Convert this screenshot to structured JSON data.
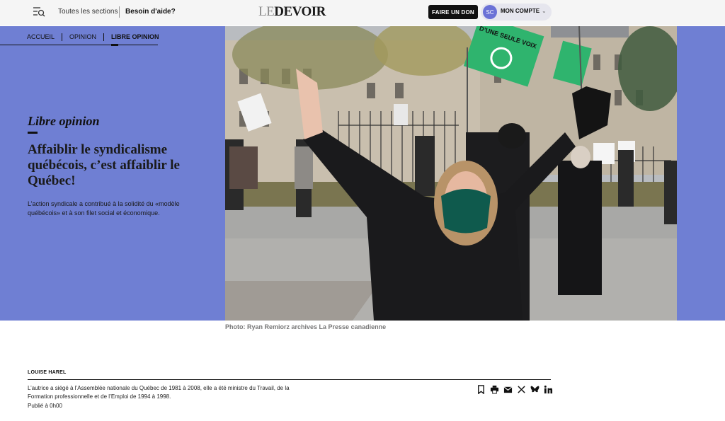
{
  "header": {
    "sections_label": "Toutes les sections",
    "help_label": "Besoin d'aide?",
    "logo_le": "LE",
    "logo_devoir": "DEVOIR",
    "donate_label": "FAIRE UN DON",
    "account_initials": "SC",
    "account_label": "MON COMPTE",
    "account_chevron": "⌄"
  },
  "breadcrumb": [
    "ACCUEIL",
    "OPINION",
    "LIBRE OPINION"
  ],
  "article": {
    "section": "Libre opinion",
    "headline": "Affaiblir le syndicalisme québécois, c’est affaiblir le Québec!",
    "dek": "L’action syndicale a contribué à la solidité du «modèle québécois» et à son filet social et économique.",
    "caption": "Photo: Ryan Remiorz archives La Presse canadienne",
    "author": "LOUISE HAREL",
    "author_bio": "L’autrice a siégé à l’Assemblée nationale du Québec de 1981 à 2008, elle a été ministre du Travail, de la Formation professionnelle et de l’Emploi de 1994 à 1998.",
    "published": "Publié à 0h00"
  },
  "photo": {
    "sign_text": "D’UNE SEULE VOIX"
  },
  "share_icons": [
    "bookmark-icon",
    "print-icon",
    "email-icon",
    "x-icon",
    "bluesky-icon",
    "linkedin-icon"
  ],
  "colors": {
    "hero_bg": "#6f7fd3",
    "topbar_bg": "#f5f5f5",
    "donate_bg": "#111111",
    "avatar_bg": "#6b72d6",
    "sign_green": "#2fb46e"
  }
}
